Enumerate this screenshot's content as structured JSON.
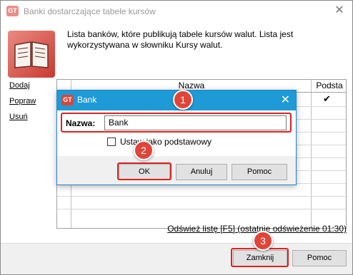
{
  "window": {
    "title": "Banki dostarczające tabele kursów",
    "app_icon": "GT",
    "close_glyph": "✕"
  },
  "description": "Lista banków, które publikują tabele kursów walut. Lista jest wykorzystywana w słowniku Kursy walut.",
  "side_links": {
    "add": "Dodaj",
    "edit": "Popraw",
    "delete": "Usuń"
  },
  "table": {
    "columns": [
      "Nazwa",
      "Podsta"
    ],
    "first_row_base_checked": "✔"
  },
  "refresh_link": "Odśwież listę [F5] (ostatnie odświeżenie 01:30)",
  "footer": {
    "close": "Zamknij",
    "help": "Pomoc"
  },
  "dialog": {
    "title": "Bank",
    "icon": "GT",
    "close_glyph": "✕",
    "name_label": "Nazwa:",
    "name_value": "Bank",
    "default_checkbox_label": "Ustaw jako podstawowy",
    "buttons": {
      "ok": "OK",
      "cancel": "Anuluj",
      "help": "Pomoc"
    }
  },
  "steps": [
    "1",
    "2",
    "3"
  ],
  "colors": {
    "accent": "#1e9ad6",
    "highlight": "#e02020",
    "badge": "#e0453a"
  }
}
